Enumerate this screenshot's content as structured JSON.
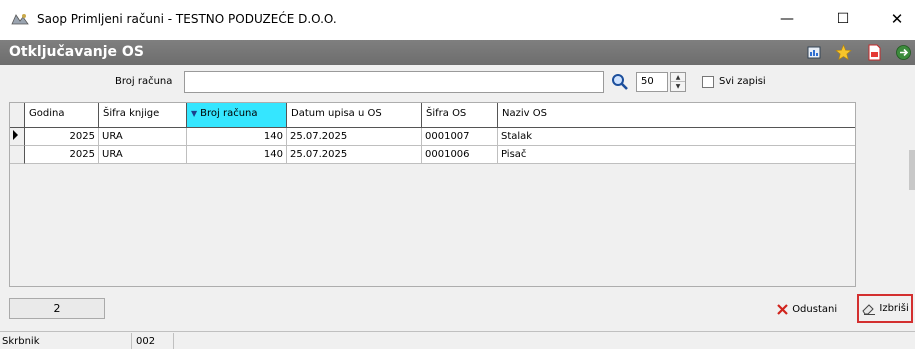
{
  "window": {
    "title": "Saop Primljeni računi - TESTNO PODUZEĆE D.O.O.",
    "minimize": "—",
    "maximize": "☐",
    "close": "✕"
  },
  "form": {
    "title": "Otključavanje OS",
    "toolbar_icons": [
      "report-icon",
      "star-icon",
      "pdf-icon",
      "exit-icon"
    ]
  },
  "search": {
    "label": "Broj računa",
    "value": "",
    "page_size": "50",
    "all_records_label": "Svi zapisi",
    "all_records_checked": false
  },
  "grid": {
    "columns": [
      "Godina",
      "Šifra knjige",
      "Broj računa",
      "Datum upisa u OS",
      "Šifra OS",
      "Naziv OS"
    ],
    "sorted_column": "Broj računa",
    "rows": [
      [
        "2025",
        "URA",
        "140",
        "25.07.2025",
        "0001007",
        "Stalak"
      ],
      [
        "2025",
        "URA",
        "140",
        "25.07.2025",
        "0001006",
        "Pisač"
      ]
    ]
  },
  "footer": {
    "record_count": "2",
    "cancel_label": "Odustani",
    "delete_label": "Izbriši"
  },
  "statusbar": {
    "user": "Skrbnik",
    "code": "002"
  },
  "colors": {
    "sorted_header": "#35e6ff",
    "header_bar": "#777777",
    "highlight_border": "#d32f2f"
  }
}
